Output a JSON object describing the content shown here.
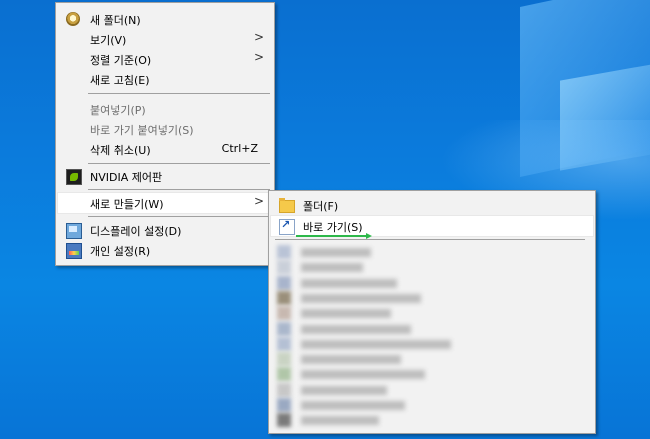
{
  "context_menu": {
    "items": [
      {
        "label": "새 폴더(N)",
        "icon": "new-folder-icon"
      },
      {
        "label": "보기(V)",
        "has_submenu": true
      },
      {
        "label": "정렬 기준(O)",
        "has_submenu": true
      },
      {
        "label": "새로 고침(E)"
      },
      {
        "label": "붙여넣기(P)",
        "disabled": true
      },
      {
        "label": "바로 가기 붙여넣기(S)",
        "disabled": true
      },
      {
        "label": "삭제 취소(U)",
        "shortcut": "Ctrl+Z"
      },
      {
        "label": "NVIDIA 제어판",
        "icon": "nvidia-icon"
      },
      {
        "label": "새로 만들기(W)",
        "has_submenu": true,
        "highlighted": true
      },
      {
        "label": "디스플레이 설정(D)",
        "icon": "display-icon"
      },
      {
        "label": "개인 설정(R)",
        "icon": "personalize-icon"
      }
    ],
    "submenu_arrow": ">"
  },
  "new_submenu": {
    "items": [
      {
        "label": "폴더(F)",
        "icon": "folder-icon"
      },
      {
        "label": "바로 가기(S)",
        "icon": "shortcut-icon",
        "highlighted": true
      }
    ],
    "blurred_item_count": 12
  },
  "colors": {
    "desktop_blue": "#0a7bdc",
    "menu_bg": "#f2f2f2",
    "highlight_bg": "#ffffff",
    "annotation_arrow": "#2db84a"
  }
}
